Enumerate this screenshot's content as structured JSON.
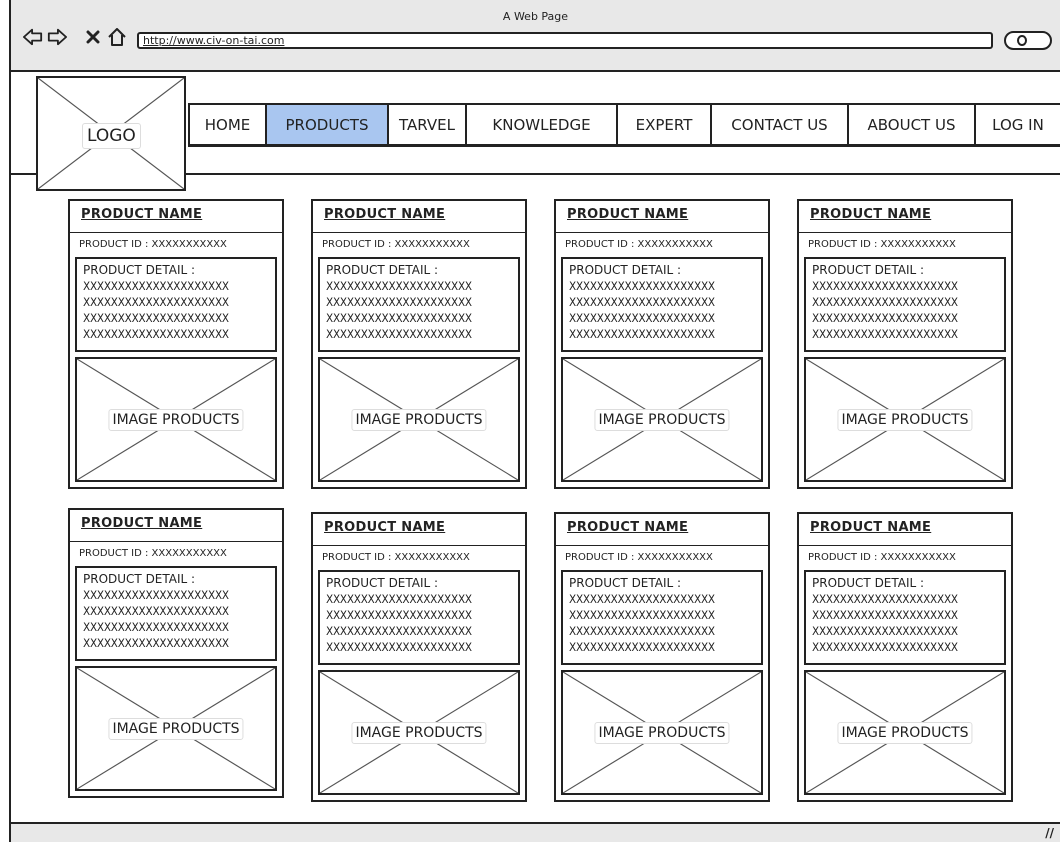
{
  "window": {
    "title": "A Web Page",
    "url": "http://www.civ-on-tai.com",
    "nav_icons": [
      "back-arrow-icon",
      "forward-arrow-icon",
      "close-icon",
      "home-icon",
      "search-icon"
    ]
  },
  "header": {
    "logo_label": "LOGO"
  },
  "nav": {
    "active": "PRODUCTS",
    "active_color": "#a9c6f0",
    "items": [
      {
        "label": "HOME"
      },
      {
        "label": "PRODUCTS"
      },
      {
        "label": "TARVEL"
      },
      {
        "label": "KNOWLEDGE"
      },
      {
        "label": "EXPERT"
      },
      {
        "label": "CONTACT US"
      },
      {
        "label": "ABOUCT US"
      },
      {
        "label": "LOG IN"
      }
    ]
  },
  "products": [
    {
      "name": "PRODUCT NAME",
      "id_line": "PRODUCT ID : XXXXXXXXXXX",
      "detail_title": "PRODUCT DETAIL :",
      "detail_lines": [
        "XXXXXXXXXXXXXXXXXXXXX",
        "XXXXXXXXXXXXXXXXXXXXX",
        "XXXXXXXXXXXXXXXXXXXXX",
        "XXXXXXXXXXXXXXXXXXXXX"
      ],
      "image_label": "IMAGE PRODUCTS"
    },
    {
      "name": "PRODUCT NAME",
      "id_line": "PRODUCT ID : XXXXXXXXXXX",
      "detail_title": "PRODUCT DETAIL :",
      "detail_lines": [
        "XXXXXXXXXXXXXXXXXXXXX",
        "XXXXXXXXXXXXXXXXXXXXX",
        "XXXXXXXXXXXXXXXXXXXXX",
        "XXXXXXXXXXXXXXXXXXXXX"
      ],
      "image_label": "IMAGE PRODUCTS"
    },
    {
      "name": "PRODUCT NAME",
      "id_line": "PRODUCT ID : XXXXXXXXXXX",
      "detail_title": "PRODUCT DETAIL :",
      "detail_lines": [
        "XXXXXXXXXXXXXXXXXXXXX",
        "XXXXXXXXXXXXXXXXXXXXX",
        "XXXXXXXXXXXXXXXXXXXXX",
        "XXXXXXXXXXXXXXXXXXXXX"
      ],
      "image_label": "IMAGE PRODUCTS"
    },
    {
      "name": "PRODUCT NAME",
      "id_line": "PRODUCT ID : XXXXXXXXXXX",
      "detail_title": "PRODUCT DETAIL :",
      "detail_lines": [
        "XXXXXXXXXXXXXXXXXXXXX",
        "XXXXXXXXXXXXXXXXXXXXX",
        "XXXXXXXXXXXXXXXXXXXXX",
        "XXXXXXXXXXXXXXXXXXXXX"
      ],
      "image_label": "IMAGE PRODUCTS"
    },
    {
      "name": "PRODUCT NAME",
      "id_line": "PRODUCT ID : XXXXXXXXXXX",
      "detail_title": "PRODUCT DETAIL :",
      "detail_lines": [
        "XXXXXXXXXXXXXXXXXXXXX",
        "XXXXXXXXXXXXXXXXXXXXX",
        "XXXXXXXXXXXXXXXXXXXXX",
        "XXXXXXXXXXXXXXXXXXXXX"
      ],
      "image_label": "IMAGE PRODUCTS"
    },
    {
      "name": "PRODUCT NAME",
      "id_line": "PRODUCT ID : XXXXXXXXXXX",
      "detail_title": "PRODUCT DETAIL :",
      "detail_lines": [
        "XXXXXXXXXXXXXXXXXXXXX",
        "XXXXXXXXXXXXXXXXXXXXX",
        "XXXXXXXXXXXXXXXXXXXXX",
        "XXXXXXXXXXXXXXXXXXXXX"
      ],
      "image_label": "IMAGE PRODUCTS"
    },
    {
      "name": "PRODUCT NAME",
      "id_line": "PRODUCT ID : XXXXXXXXXXX",
      "detail_title": "PRODUCT DETAIL :",
      "detail_lines": [
        "XXXXXXXXXXXXXXXXXXXXX",
        "XXXXXXXXXXXXXXXXXXXXX",
        "XXXXXXXXXXXXXXXXXXXXX",
        "XXXXXXXXXXXXXXXXXXXXX"
      ],
      "image_label": "IMAGE PRODUCTS"
    },
    {
      "name": "PRODUCT NAME",
      "id_line": "PRODUCT ID : XXXXXXXXXXX",
      "detail_title": "PRODUCT DETAIL :",
      "detail_lines": [
        "XXXXXXXXXXXXXXXXXXXXX",
        "XXXXXXXXXXXXXXXXXXXXX",
        "XXXXXXXXXXXXXXXXXXXXX",
        "XXXXXXXXXXXXXXXXXXXXX"
      ],
      "image_label": "IMAGE PRODUCTS"
    }
  ]
}
